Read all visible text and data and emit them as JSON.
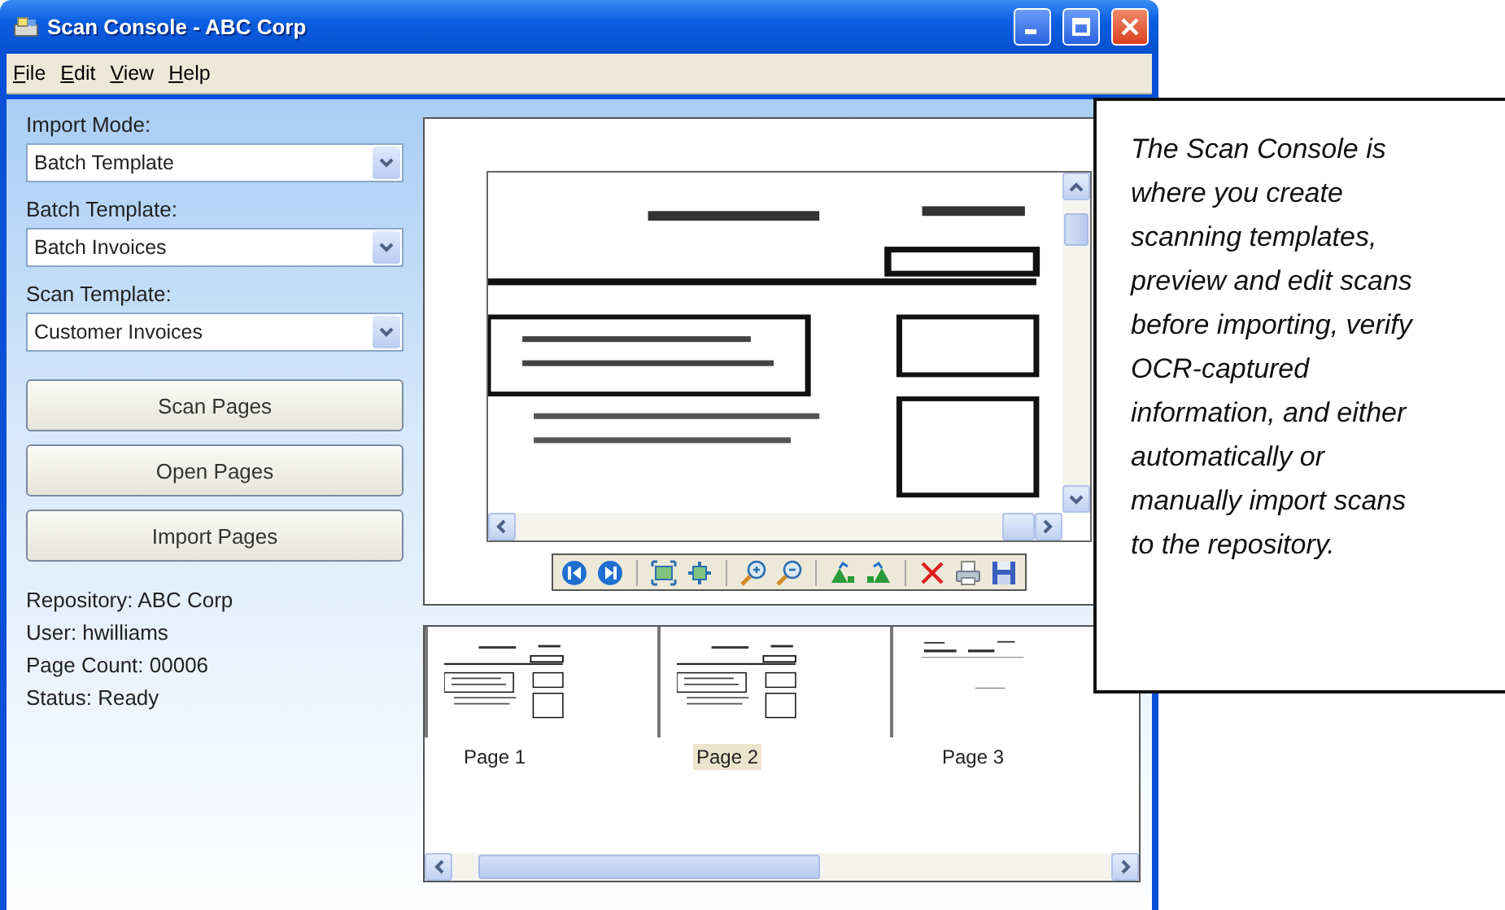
{
  "window": {
    "title": "Scan Console - ABC Corp"
  },
  "menu": [
    {
      "label": "File"
    },
    {
      "label": "Edit"
    },
    {
      "label": "View"
    },
    {
      "label": "Help"
    }
  ],
  "fields": [
    {
      "label": "Import Mode:",
      "value": "Batch Template"
    },
    {
      "label": "Batch Template:",
      "value": "Batch Invoices"
    },
    {
      "label": "Scan Template:",
      "value": "Customer Invoices"
    }
  ],
  "buttons": [
    "Scan Pages",
    "Open Pages",
    "Import Pages"
  ],
  "info": [
    "Repository: ABC Corp",
    "User: hwilliams",
    "Page Count: 00006",
    "Status: Ready"
  ],
  "thumbnails": [
    {
      "label": "Page 1",
      "selected": false,
      "kind": "invoice"
    },
    {
      "label": "Page 2",
      "selected": true,
      "kind": "invoice"
    },
    {
      "label": "Page 3",
      "selected": false,
      "kind": "sparse"
    }
  ],
  "callout": "The Scan Console is where you create scanning templates, preview and edit scans before importing, verify OCR-captured information, and either automatically or manually import scans to the repository."
}
